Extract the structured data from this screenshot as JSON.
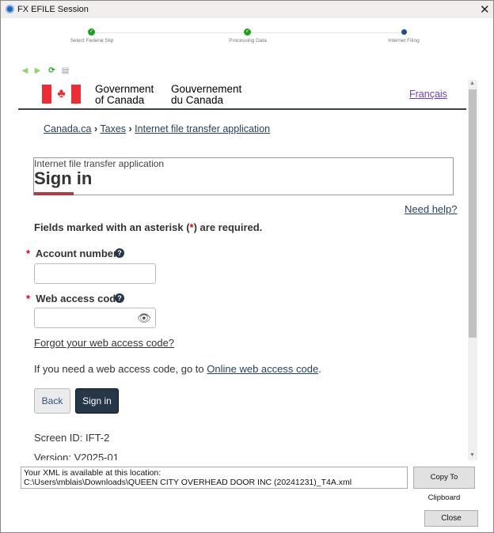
{
  "window": {
    "title": "FX EFILE Session"
  },
  "stepper": [
    {
      "label": "Select Federal Slip",
      "state": "done"
    },
    {
      "label": "Processing Data",
      "state": "done"
    },
    {
      "label": "Internet Filing",
      "state": "current"
    }
  ],
  "colors": {
    "done": "#1ea01e",
    "current": "#1f4e8c",
    "link": "#284162",
    "brand_red": "#af3c43",
    "button_dark": "#26374a"
  },
  "toolbar": [
    "back-arrow-icon",
    "forward-arrow-icon",
    "refresh-icon",
    "print-icon"
  ],
  "header": {
    "gov_en_1": "Government",
    "gov_en_2": "of Canada",
    "gov_fr_1": "Gouvernement",
    "gov_fr_2": "du Canada",
    "lang_link": "Français"
  },
  "breadcrumb": [
    "Canada.ca",
    "Taxes",
    "Internet file transfer application"
  ],
  "page": {
    "subtitle": "Internet file transfer application",
    "title": "Sign in",
    "need_help": "Need help?",
    "required_pre": "Fields marked with an asterisk (",
    "asterisk": "*",
    "required_post": ") are required.",
    "account_label": "Account number",
    "account_value": "",
    "wac_label": "Web access code",
    "wac_value": "",
    "forgot": "Forgot your web access code?",
    "info_pre": "If you need a web access code, go to ",
    "info_link": "Online web access code",
    "info_post": ".",
    "back": "Back",
    "sign_in": "Sign in",
    "screen_id": "Screen ID: IFT-2",
    "version": "Version: V2025-01"
  },
  "footer": {
    "xml_line1": "Your XML is available at this location:",
    "xml_line2": "C:\\Users\\mblais\\Downloads\\QUEEN CITY OVERHEAD DOOR INC (20241231)_T4A.xml",
    "copy": "Copy To Clipboard",
    "close": "Close"
  }
}
